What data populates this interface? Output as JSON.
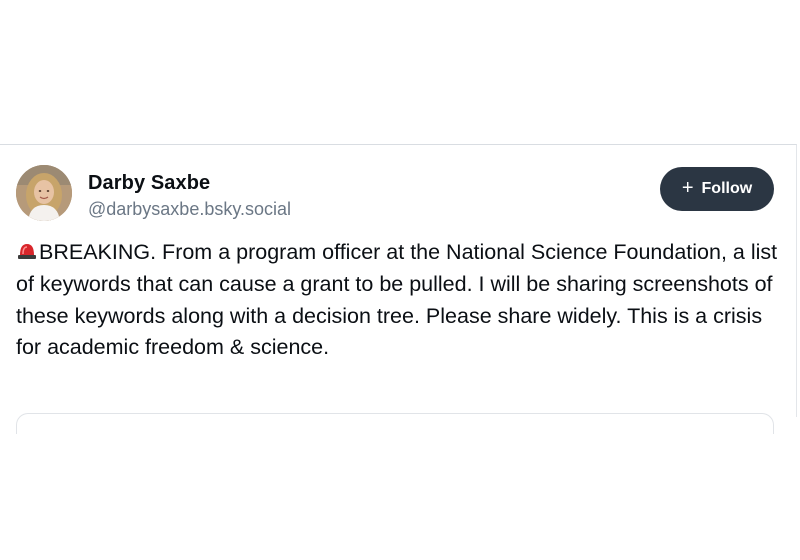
{
  "post": {
    "author": {
      "display_name": "Darby Saxbe",
      "handle": "@darbysaxbe.bsky.social",
      "avatar_icon": "profile-photo"
    },
    "follow_button": {
      "icon": "plus-icon",
      "label": "Follow",
      "background": "#2b3643"
    },
    "text_icon": "police-siren-emoji",
    "text": "BREAKING. From a program officer at the National Science Foundation, a list of keywords that can cause a grant to be pulled. I will be sharing screenshots of these keywords along with a decision tree. Please share widely. This is a crisis for academic freedom & science."
  }
}
